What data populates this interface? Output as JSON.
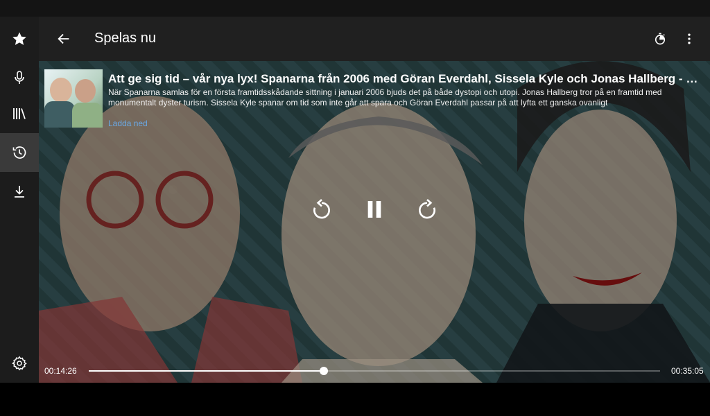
{
  "toolbar": {
    "title": "Spelas nu",
    "icons": {
      "back": "arrow-back-icon",
      "timer": "sleep-timer-icon",
      "more": "more-vert-icon"
    }
  },
  "sidebar": {
    "items": [
      {
        "name": "favorites",
        "icon": "star-icon"
      },
      {
        "name": "podcasts",
        "icon": "microphone-icon"
      },
      {
        "name": "library",
        "icon": "library-icon"
      },
      {
        "name": "history",
        "icon": "history-icon",
        "active": true
      },
      {
        "name": "downloads",
        "icon": "download-icon"
      },
      {
        "name": "settings",
        "icon": "gear-icon"
      }
    ]
  },
  "episode": {
    "title": "Att ge sig tid – vår nya lyx! Spanarna från 2006 med Göran Everdahl, Sissela Kyle och Jonas Hallberg - Spanarna",
    "description": "När Spanarna samlas för en första framtidsskådande sittning i januari 2006 bjuds det på både dystopi och utopi. Jonas Hallberg tror på en framtid med monumentalt dyster turism. Sissela Kyle spanar om tid som inte går att spara och Göran Everdahl passar på att lyfta ett ganska ovanligt",
    "download_label": "Ladda ned"
  },
  "player": {
    "elapsed": "00:14:26",
    "duration": "00:35:05",
    "progress": 0.411,
    "controls": {
      "rewind": "replay-icon",
      "pause": "pause-icon",
      "forward": "forward-icon"
    }
  },
  "colors": {
    "accent_link": "#6aa9e6",
    "toolbar": "#202020",
    "sidebar": "#1c1c1c"
  }
}
